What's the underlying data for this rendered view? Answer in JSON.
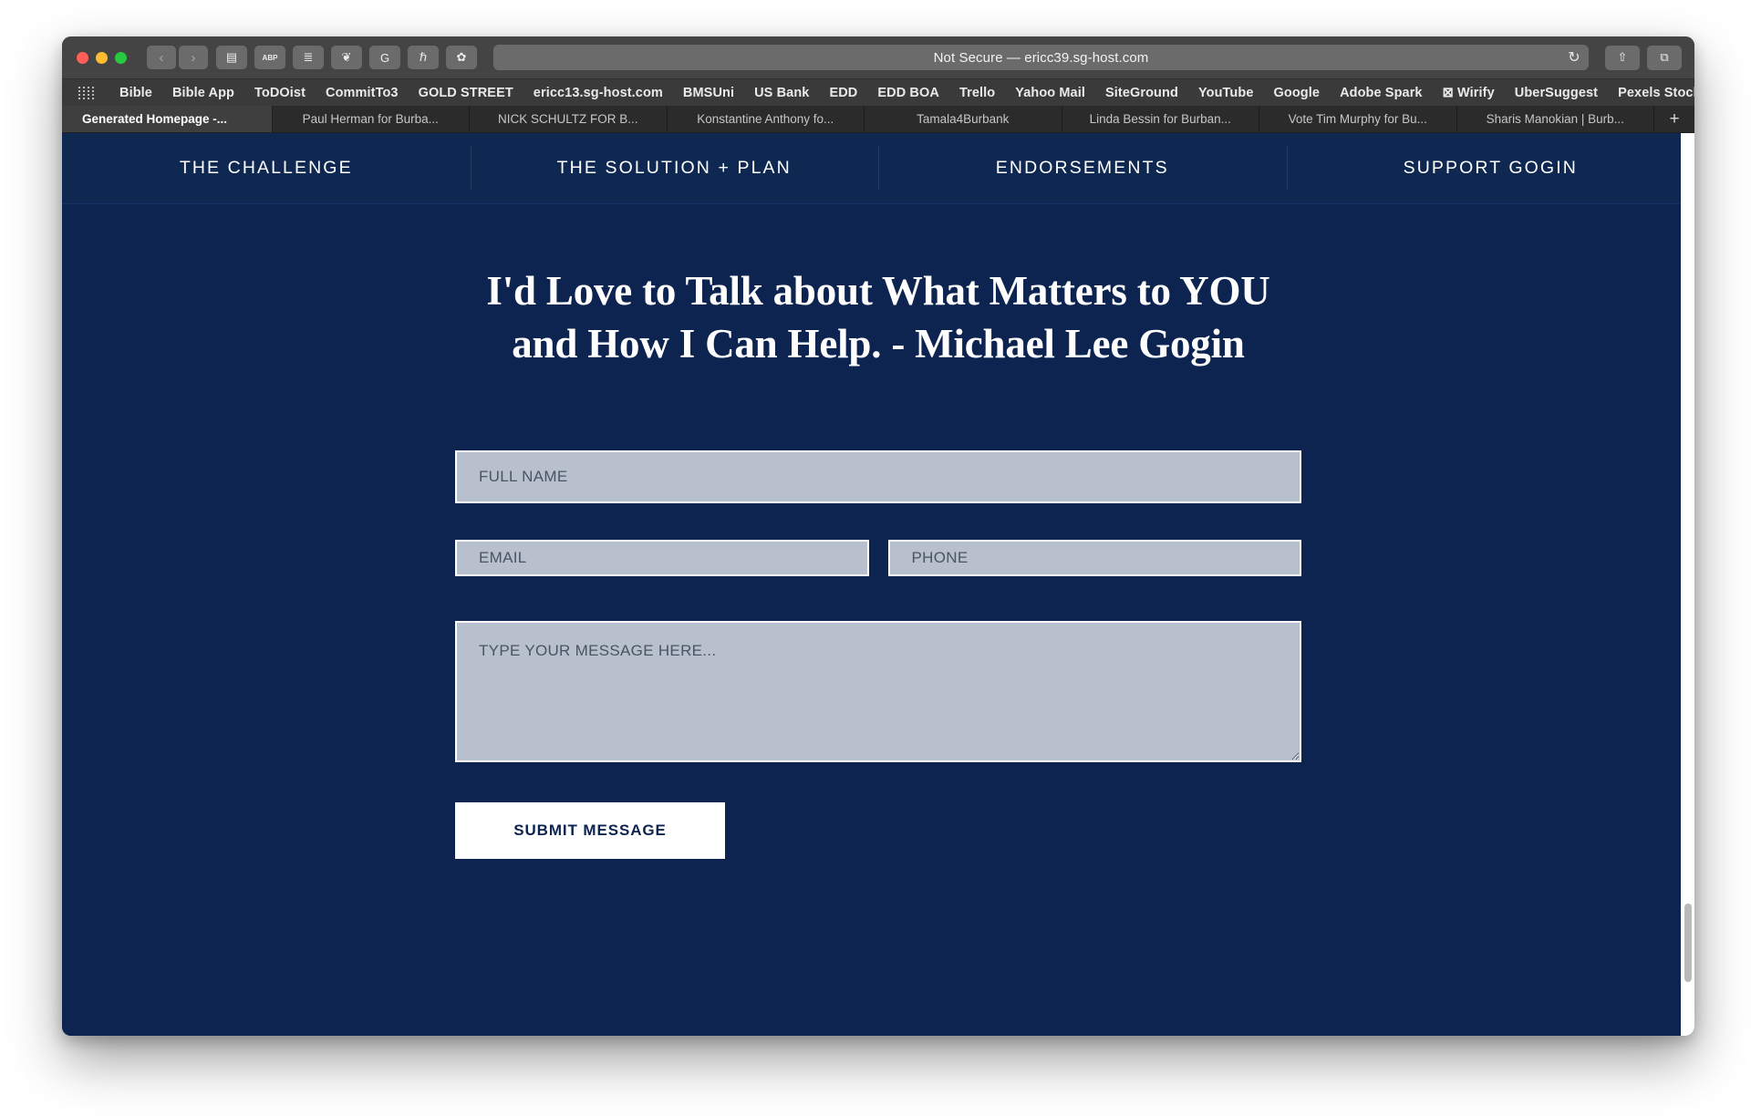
{
  "browser": {
    "traffic_lights": [
      "close",
      "minimize",
      "zoom"
    ],
    "nav_back_label": "‹",
    "nav_forward_label": "›",
    "url_text": "Not Secure — ericc39.sg-host.com",
    "reload_label": "↻",
    "extensions": [
      {
        "name": "sidebar-toggle-icon",
        "glyph": "▤"
      },
      {
        "name": "adblock-plus-icon",
        "glyph": "ABP"
      },
      {
        "name": "pocket-icon",
        "glyph": "≣"
      },
      {
        "name": "evernote-clipper-icon",
        "glyph": "❦"
      },
      {
        "name": "grammarly-icon",
        "glyph": "G"
      },
      {
        "name": "honey-icon",
        "glyph": "ℏ"
      },
      {
        "name": "evernote-icon",
        "glyph": "✿"
      }
    ],
    "share_label": "⇧",
    "tab_overview_label": "⧉",
    "bookmarks": [
      "Bible",
      "Bible App",
      "ToDOist",
      "CommitTo3",
      "GOLD STREET",
      "ericc13.sg-host.com",
      "BMSUni",
      "US Bank",
      "EDD",
      "EDD BOA",
      "Trello",
      "Yahoo Mail",
      "SiteGround",
      "YouTube",
      "Google",
      "Adobe Spark",
      "⊠ Wirify",
      "UberSuggest",
      "Pexels Stock"
    ],
    "bookmarks_overflow_label": "»",
    "tabs": [
      {
        "title": "Generated Homepage -...",
        "active": true
      },
      {
        "title": "Paul Herman for Burba...",
        "active": false
      },
      {
        "title": "NICK SCHULTZ FOR B...",
        "active": false
      },
      {
        "title": "Konstantine Anthony fo...",
        "active": false
      },
      {
        "title": "Tamala4Burbank",
        "active": false
      },
      {
        "title": "Linda Bessin for Burban...",
        "active": false
      },
      {
        "title": "Vote Tim Murphy for Bu...",
        "active": false
      },
      {
        "title": "Sharis Manokian | Burb...",
        "active": false
      }
    ],
    "new_tab_label": "+"
  },
  "page": {
    "nav": [
      {
        "label": "THE CHALLENGE"
      },
      {
        "label": "THE SOLUTION + PLAN"
      },
      {
        "label": "ENDORSEMENTS"
      },
      {
        "label": "SUPPORT GOGIN"
      }
    ],
    "headline_line1": "I'd Love to Talk about What Matters to YOU",
    "headline_line2": "and How I Can Help. - Michael Lee Gogin",
    "form": {
      "fullname_placeholder": "FULL NAME",
      "fullname_value": "",
      "email_placeholder": "EMAIL",
      "email_value": "",
      "phone_placeholder": "PHONE",
      "phone_value": "",
      "message_placeholder": "TYPE YOUR MESSAGE HERE...",
      "message_value": "",
      "submit_label": "SUBMIT MESSAGE"
    },
    "colors": {
      "page_background": "#0d2450",
      "nav_background": "#0f2851",
      "field_fill": "#b7c0cc",
      "field_border": "#ffffff",
      "submit_background": "#ffffff",
      "submit_text": "#0d2450"
    }
  }
}
